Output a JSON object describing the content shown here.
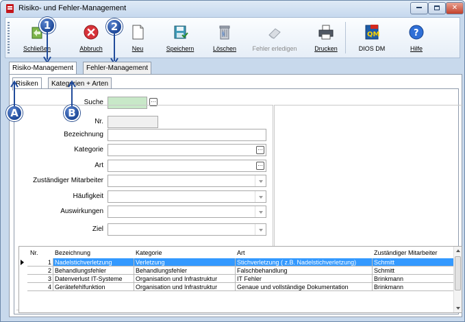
{
  "window": {
    "title": "Risiko- und Fehler-Management"
  },
  "toolbar": {
    "buttons": [
      {
        "label": "Schließen",
        "icon": "exit-door-icon"
      },
      {
        "label": "Abbruch",
        "icon": "cancel-icon"
      },
      {
        "label": "Neu",
        "icon": "new-document-icon"
      },
      {
        "label": "Speichern",
        "icon": "save-icon"
      },
      {
        "label": "Löschen",
        "icon": "trash-icon"
      },
      {
        "label": "Fehler erledigen",
        "icon": "eraser-icon",
        "disabled": true
      },
      {
        "label": "Drucken",
        "icon": "printer-icon"
      },
      {
        "label": "DIOS DM",
        "icon": "qm-pdf-icon"
      },
      {
        "label": "Hilfe",
        "icon": "help-icon"
      }
    ]
  },
  "callouts": {
    "one": "1",
    "two": "2",
    "a": "A",
    "b": "B"
  },
  "main_tabs": [
    "Risiko-Management",
    "Fehler-Management"
  ],
  "sub_tabs": [
    "Risiken",
    "Kategorien + Arten"
  ],
  "search": {
    "label": "Suche",
    "value": ""
  },
  "form": {
    "nr_label": "Nr.",
    "bezeichnung_label": "Bezeichnung",
    "kategorie_label": "Kategorie",
    "art_label": "Art",
    "mitarbeiter_label": "Zuständiger Mitarbeiter",
    "haeufigkeit_label": "Häufigkeit",
    "auswirkungen_label": "Auswirkungen",
    "ziel_label": "Ziel"
  },
  "grid": {
    "headers": [
      "Nr.",
      "Bezeichnung",
      "Kategorie",
      "Art",
      "Zuständiger Mitarbeiter"
    ],
    "rows": [
      {
        "nr": "1",
        "bezeichnung": "Nadelstichverletzung",
        "kategorie": "Verletzung",
        "art": "Stichverletzung ( z.B. Nadelstichverletzung)",
        "mitarbeiter": "Schmitt"
      },
      {
        "nr": "2",
        "bezeichnung": "Behandlungsfehler",
        "kategorie": "Behandlungsfehler",
        "art": "Falschbehandlung",
        "mitarbeiter": "Schmitt"
      },
      {
        "nr": "3",
        "bezeichnung": "Datenverlust IT-Systeme",
        "kategorie": "Organisation und Infrastruktur",
        "art": "IT Fehler",
        "mitarbeiter": "Brinkmann"
      },
      {
        "nr": "4",
        "bezeichnung": "Gerätefehlfunktion",
        "kategorie": "Organisation und Infrastruktur",
        "art": "Genaue und vollständige Dokumentation",
        "mitarbeiter": "Brinkmann"
      }
    ]
  },
  "colors": {
    "selection": "#3399ff",
    "callout": "#1f4a9a",
    "search_field": "#c8e8c8"
  }
}
